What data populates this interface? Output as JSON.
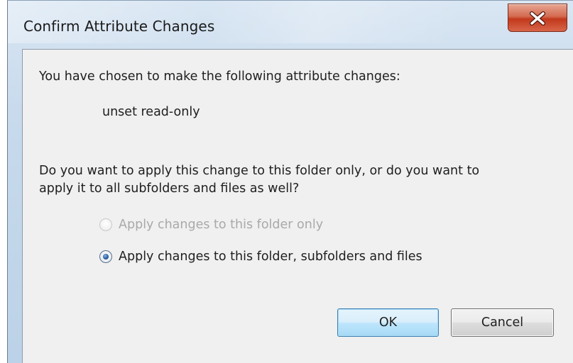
{
  "window": {
    "title": "Confirm Attribute Changes"
  },
  "dialog": {
    "intro": "You have chosen to make the following attribute changes:",
    "change": "unset read-only",
    "question_line1": "Do you want to apply this change to this folder only, or do you want to",
    "question_line2": "apply it to all subfolders and files as well?",
    "options": [
      {
        "label": "Apply changes to this folder only",
        "selected": false,
        "enabled": false
      },
      {
        "label": "Apply changes to this folder, subfolders and files",
        "selected": true,
        "enabled": true
      }
    ],
    "ok_label": "OK",
    "cancel_label": "Cancel"
  },
  "colors": {
    "close_button": "#c2391c",
    "dialog_background": "#f0f0f0",
    "default_button_border": "#3c7fb1",
    "disabled_text": "#a9a9a9"
  },
  "icons": {
    "close": "close-icon",
    "radio_checked": "radio-checked-icon",
    "radio_unchecked": "radio-unchecked-icon"
  }
}
